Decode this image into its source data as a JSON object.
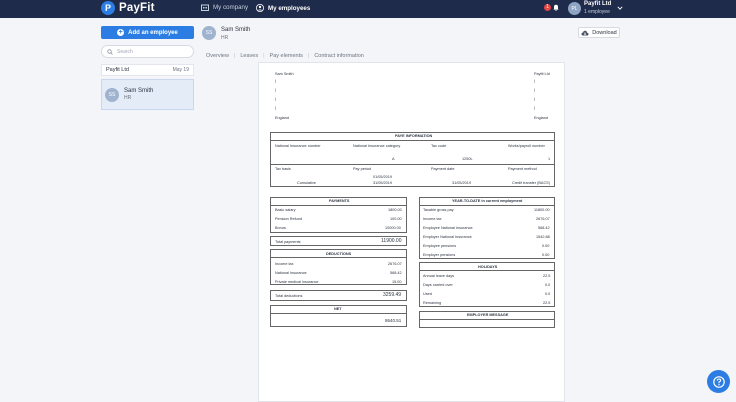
{
  "app": {
    "logo_letter": "P",
    "logo_text": "PayFit",
    "nav_company": "My company",
    "nav_employees": "My employees",
    "notification_count": "1",
    "org_initials": "PL",
    "org_name": "Payfit Ltd",
    "org_sub": "1 employee"
  },
  "sidebar": {
    "add_button": "Add an employee",
    "search_placeholder": "Search",
    "company_row": {
      "name": "Payfit Ltd",
      "date": "May 19"
    },
    "employee": {
      "initials": "SS",
      "name": "Sam Smith",
      "role": "HR"
    }
  },
  "header": {
    "initials": "SS",
    "name": "Sam Smith",
    "role": "HR",
    "tabs": [
      "Overview",
      "Leaves",
      "Pay elements",
      "Contract information"
    ],
    "download": "Download"
  },
  "payslip": {
    "employee_name": "Sam Smith",
    "company_name": "Payfit Ltd",
    "employee_country": "England",
    "company_country": "England",
    "paye": {
      "title": "PAYE INFORMATION",
      "ni_number_label": "National Insurance number",
      "ni_category_label": "National Insurance category",
      "ni_category_value": "A",
      "tax_code_label": "Tax code",
      "tax_code_value": "1250L",
      "works_number_label": "Works/payroll number",
      "works_number_value": "1",
      "tax_basis_label": "Tax basis",
      "tax_basis_value": "Cumulative",
      "pay_period_label": "Pay period",
      "pay_period_from": "01/05/2019",
      "pay_period_to": "31/05/2019",
      "payment_date_label": "Payment date",
      "payment_date_value": "31/05/2019",
      "payment_method_label": "Payment method",
      "payment_method_value": "Credit transfer (BACS)"
    },
    "payments": {
      "title": "PAYMENTS",
      "rows": [
        {
          "label": "Basic salary",
          "value": "1800.00"
        },
        {
          "label": "Pension Refund",
          "value": "100.00"
        },
        {
          "label": "Bonus",
          "value": "10000.00"
        }
      ],
      "total_label": "Total payments",
      "total_value": "11900.00"
    },
    "deductions": {
      "title": "DEDUCTIONS",
      "rows": [
        {
          "label": "Income tax",
          "value": "2676.07"
        },
        {
          "label": "National Insurance",
          "value": "568.42"
        },
        {
          "label": "Private medical insurance",
          "value": "15.00"
        }
      ],
      "total_label": "Total deductions",
      "total_value": "3259.49"
    },
    "net": {
      "title": "NET",
      "value": "8640.51"
    },
    "ytd": {
      "title": "YEAR-TO-DATE in current employment",
      "rows": [
        {
          "label": "Taxable gross pay",
          "value": "11800.00"
        },
        {
          "label": "Income tax",
          "value": "2676.07"
        },
        {
          "label": "Employee National Insurance",
          "value": "568.42"
        },
        {
          "label": "Employer National Insurance",
          "value": "1542.88"
        },
        {
          "label": "Employee pensions",
          "value": "0.00"
        },
        {
          "label": "Employer pensions",
          "value": "0.00"
        }
      ]
    },
    "holidays": {
      "title": "HOLIDAYS",
      "rows": [
        {
          "label": "Annual leave days",
          "value": "22.5"
        },
        {
          "label": "Days carried over",
          "value": "0.0"
        },
        {
          "label": "Used",
          "value": "0.0"
        },
        {
          "label": "Remaining",
          "value": "22.5"
        }
      ]
    },
    "employer_message": {
      "title": "EMPLOYER MESSAGE"
    }
  },
  "help_label": "?"
}
